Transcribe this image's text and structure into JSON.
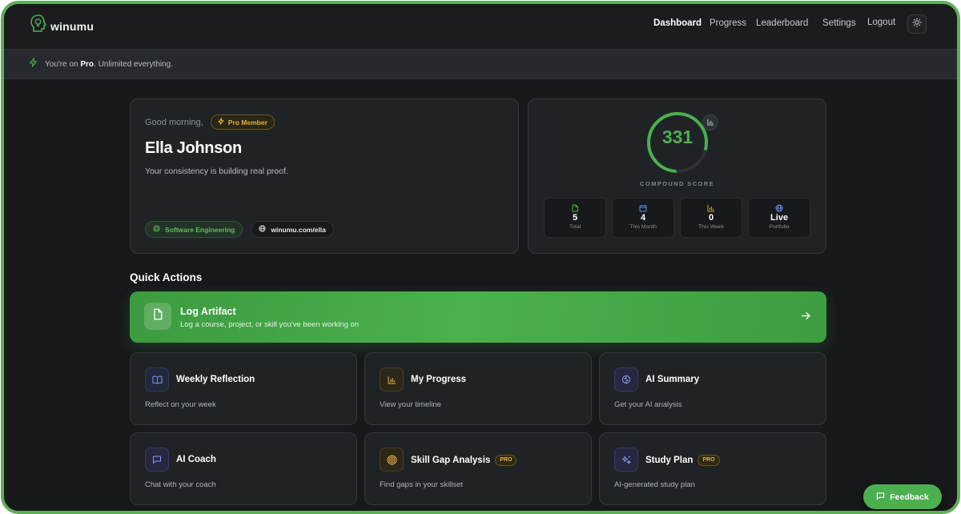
{
  "app": {
    "name": "winumu"
  },
  "nav": {
    "items": [
      "Dashboard",
      "Progress",
      "Leaderboard",
      "Settings",
      "Logout"
    ],
    "active": "Dashboard"
  },
  "banner": {
    "prefix": "You're on ",
    "plan": "Pro",
    "suffix": ". Unlimited everything."
  },
  "profile": {
    "greeting": "Good morning,",
    "badge": "Pro Member",
    "name": "Ella Johnson",
    "tagline": "Your consistency is building real proof.",
    "field": "Software Engineering",
    "portfolio_url": "winumu.com/ella"
  },
  "score": {
    "value": "331",
    "label": "COMPOUND SCORE",
    "stats": [
      {
        "icon": "file-icon",
        "value": "5",
        "label": "Total",
        "color": "#4caf50"
      },
      {
        "icon": "calendar-icon",
        "value": "4",
        "label": "This Month",
        "color": "#5b8def"
      },
      {
        "icon": "bar-chart-icon",
        "value": "0",
        "label": "This Week",
        "color": "#e2a33d"
      },
      {
        "icon": "globe-icon",
        "value": "Live",
        "label": "Portfolio",
        "color": "#7b8cf0"
      }
    ]
  },
  "quick_actions": {
    "title": "Quick Actions",
    "primary": {
      "title": "Log Artifact",
      "subtitle": "Log a course, project, or skill you've been working on",
      "icon": "file-icon"
    },
    "items": [
      {
        "title": "Weekly Reflection",
        "subtitle": "Reflect on your week",
        "icon": "book-icon",
        "pro": ""
      },
      {
        "title": "My Progress",
        "subtitle": "View your timeline",
        "icon": "bar-chart-icon",
        "pro": ""
      },
      {
        "title": "AI Summary",
        "subtitle": "Get your AI analysis",
        "icon": "brain-icon",
        "pro": ""
      },
      {
        "title": "AI Coach",
        "subtitle": "Chat with your coach",
        "icon": "chat-icon",
        "pro": ""
      },
      {
        "title": "Skill Gap Analysis",
        "subtitle": "Find gaps in your skillset",
        "icon": "target-icon",
        "pro": "PRO"
      },
      {
        "title": "Study Plan",
        "subtitle": "AI-generated study plan",
        "icon": "sparkles-icon",
        "pro": "PRO"
      }
    ]
  },
  "feedback": {
    "label": "Feedback"
  },
  "colors": {
    "accent": "#4caf50",
    "pro": "#e2b33d",
    "background": "#17191b",
    "card": "#202326"
  }
}
